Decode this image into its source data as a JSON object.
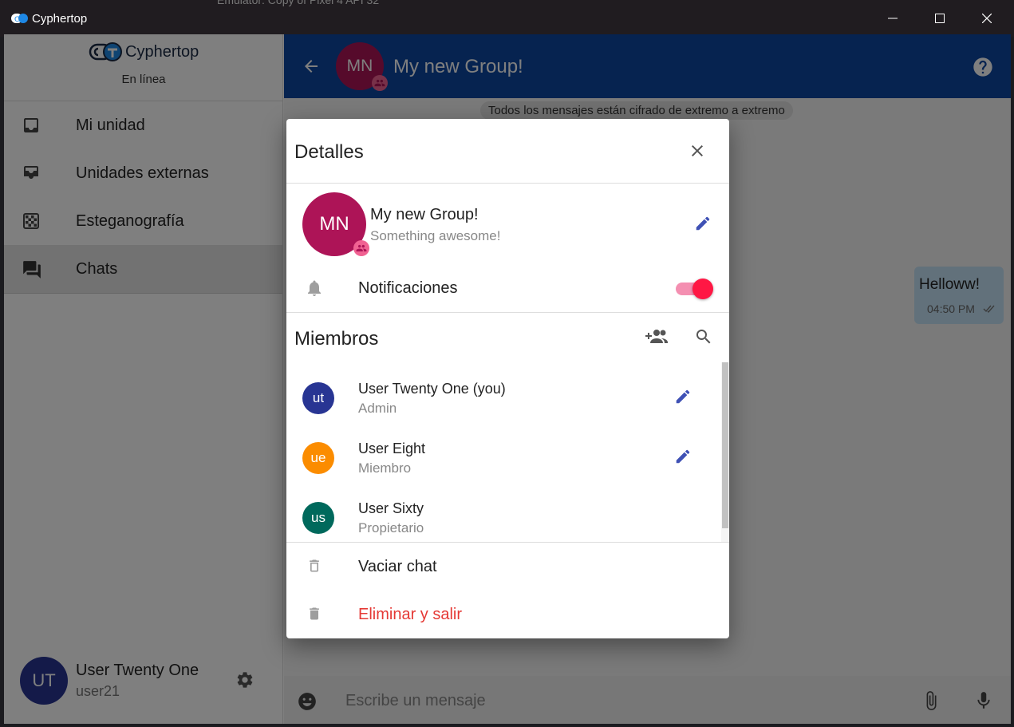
{
  "window": {
    "title": "Cyphertop",
    "background_title": "Emulator:   Copy of Pixel 4 API 32"
  },
  "sidebar": {
    "brand": "Cyphertop",
    "status": "En línea",
    "items": [
      {
        "label": "Mi unidad",
        "icon": "inbox-icon"
      },
      {
        "label": "Unidades externas",
        "icon": "external-drives-icon"
      },
      {
        "label": "Esteganografía",
        "icon": "checkerboard-icon"
      },
      {
        "label": "Chats",
        "icon": "forum-icon",
        "active": true
      }
    ],
    "user": {
      "initials": "UT",
      "name": "User Twenty One",
      "handle": "user21"
    }
  },
  "chat": {
    "header": {
      "initials": "MN",
      "title": "My new Group!"
    },
    "e2e_notice": "Todos los mensajes están cifrado de extremo a extremo",
    "messages": [
      {
        "text": "Helloww!",
        "time": "04:50 PM",
        "status": "read"
      }
    ],
    "composer": {
      "placeholder": "Escribe un mensaje"
    }
  },
  "dialog": {
    "title": "Detalles",
    "group": {
      "initials": "MN",
      "name": "My new Group!",
      "description": "Something awesome!"
    },
    "notifications": {
      "label": "Notificaciones",
      "enabled": true
    },
    "members_title": "Miembros",
    "members": [
      {
        "initials": "ut",
        "name": "User Twenty One (you)",
        "role": "Admin",
        "color": "#283593",
        "editable": true
      },
      {
        "initials": "ue",
        "name": "User Eight",
        "role": "Miembro",
        "color": "#fb8c00",
        "editable": true
      },
      {
        "initials": "us",
        "name": "User Sixty",
        "role": "Propietario",
        "color": "#00695c",
        "editable": false
      }
    ],
    "actions": {
      "clear_chat": "Vaciar chat",
      "delete_leave": "Eliminar y salir"
    }
  },
  "colors": {
    "header": "#0d47a1",
    "group_avatar": "#ad1457",
    "toggle_on": "#ff1744",
    "danger": "#e53935",
    "edit_icon": "#3f51b5"
  }
}
